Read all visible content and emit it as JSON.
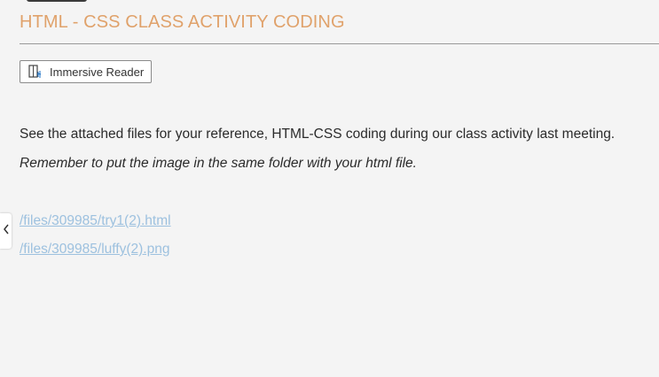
{
  "page": {
    "title": "HTML - CSS CLASS ACTIVITY CODING",
    "accent_color": "#e0a26b",
    "link_color": "#9dc1df"
  },
  "toolbar": {
    "reader_icon": "immersive-reader-icon",
    "reader_label": "Immersive Reader"
  },
  "content": {
    "paragraph_1": "See the attached files for your reference, HTML-CSS coding during our class activity last meeting.",
    "paragraph_2": "Remember to put the image in the same folder with your html file.",
    "files": [
      {
        "label": "/files/309985/try1(2).html"
      },
      {
        "label": "/files/309985/luffy(2).png"
      }
    ]
  },
  "sidebar_toggle": {
    "icon": "chevron-left-icon"
  }
}
